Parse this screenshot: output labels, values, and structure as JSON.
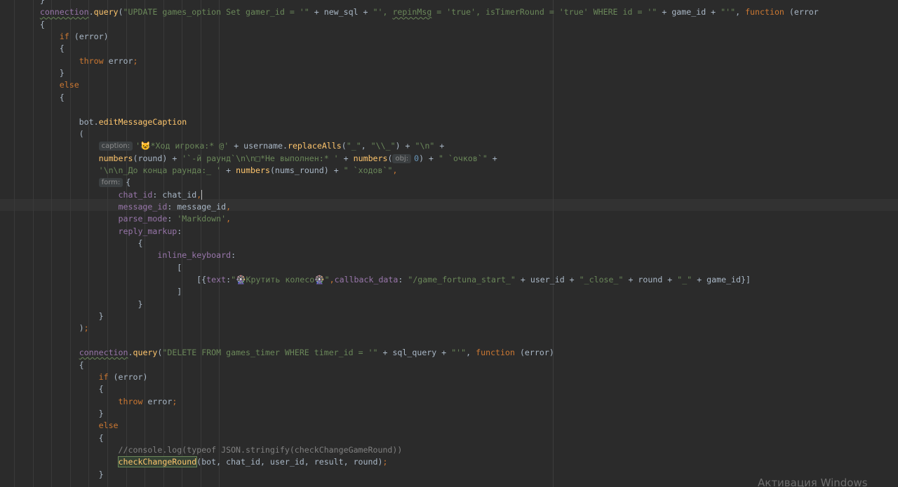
{
  "editor": {
    "lines": [
      {
        "segments": [
          {
            "t": "        }",
            "c": "op"
          }
        ]
      },
      {
        "segments": [
          {
            "t": "        ",
            "c": "op"
          },
          {
            "t": "connection",
            "c": "prop wavy"
          },
          {
            "t": ".",
            "c": "op"
          },
          {
            "t": "query",
            "c": "fn"
          },
          {
            "t": "(",
            "c": "op"
          },
          {
            "t": "\"UPDATE games_option Set gamer_id = '\"",
            "c": "str"
          },
          {
            "t": " + new_sql + ",
            "c": "op"
          },
          {
            "t": "\"', ",
            "c": "str"
          },
          {
            "t": "repinMsg",
            "c": "str wavy"
          },
          {
            "t": " = 'true', isTimerRound = 'true' WHERE id = '\"",
            "c": "str"
          },
          {
            "t": " + game_id + ",
            "c": "op"
          },
          {
            "t": "\"'\"",
            "c": "str"
          },
          {
            "t": ", ",
            "c": "op"
          },
          {
            "t": "function",
            "c": "kw"
          },
          {
            "t": " (error",
            "c": "op"
          }
        ]
      },
      {
        "segments": [
          {
            "t": "        {",
            "c": "op"
          }
        ]
      },
      {
        "segments": [
          {
            "t": "            ",
            "c": "op"
          },
          {
            "t": "if",
            "c": "kw"
          },
          {
            "t": " (error)",
            "c": "op"
          }
        ]
      },
      {
        "segments": [
          {
            "t": "            {",
            "c": "op"
          }
        ]
      },
      {
        "segments": [
          {
            "t": "                ",
            "c": "op"
          },
          {
            "t": "throw",
            "c": "kw"
          },
          {
            "t": " error",
            "c": "op"
          },
          {
            "t": ";",
            "c": "kw"
          }
        ]
      },
      {
        "segments": [
          {
            "t": "            }",
            "c": "op"
          }
        ]
      },
      {
        "segments": [
          {
            "t": "            ",
            "c": "op"
          },
          {
            "t": "else",
            "c": "kw"
          }
        ]
      },
      {
        "segments": [
          {
            "t": "            {",
            "c": "op"
          }
        ]
      },
      {
        "segments": [
          {
            "t": "",
            "c": "op"
          }
        ]
      },
      {
        "segments": [
          {
            "t": "                bot.",
            "c": "op"
          },
          {
            "t": "editMessageCaption",
            "c": "fn"
          }
        ]
      },
      {
        "segments": [
          {
            "t": "                (",
            "c": "op"
          }
        ]
      },
      {
        "segments": [
          {
            "t": "                    ",
            "c": "op"
          },
          {
            "t": "caption:",
            "c": "hint"
          },
          {
            "t": "'😺*Ход игрока:* @' ",
            "c": "str"
          },
          {
            "t": "+ username.",
            "c": "op"
          },
          {
            "t": "replaceAlls",
            "c": "fn"
          },
          {
            "t": "(",
            "c": "op"
          },
          {
            "t": "\"_\"",
            "c": "str"
          },
          {
            "t": ", ",
            "c": "op"
          },
          {
            "t": "\"\\\\_\"",
            "c": "str"
          },
          {
            "t": ") + ",
            "c": "op"
          },
          {
            "t": "\"\\n\"",
            "c": "str"
          },
          {
            "t": " +",
            "c": "op"
          }
        ]
      },
      {
        "segments": [
          {
            "t": "                    ",
            "c": "op"
          },
          {
            "t": "numbers",
            "c": "fn"
          },
          {
            "t": "(round) + ",
            "c": "op"
          },
          {
            "t": "'`-й раунд`\\n\\n□*Не выполнен:* '",
            "c": "str"
          },
          {
            "t": " + ",
            "c": "op"
          },
          {
            "t": "numbers",
            "c": "fn"
          },
          {
            "t": "(",
            "c": "op"
          },
          {
            "t": "obj:",
            "c": "hint"
          },
          {
            "t": "0",
            "c": "num"
          },
          {
            "t": ") + ",
            "c": "op"
          },
          {
            "t": "\" `очков`\"",
            "c": "str"
          },
          {
            "t": " +",
            "c": "op"
          }
        ]
      },
      {
        "segments": [
          {
            "t": "                    ",
            "c": "op"
          },
          {
            "t": "'\\n\\n_До конца раунда:_ '",
            "c": "str"
          },
          {
            "t": " + ",
            "c": "op"
          },
          {
            "t": "numbers",
            "c": "fn"
          },
          {
            "t": "(nums_round) + ",
            "c": "op"
          },
          {
            "t": "\" `ходов`\"",
            "c": "str"
          },
          {
            "t": ",",
            "c": "kw"
          }
        ]
      },
      {
        "segments": [
          {
            "t": "                    ",
            "c": "op"
          },
          {
            "t": "form:",
            "c": "hint"
          },
          {
            "t": "{",
            "c": "op"
          }
        ]
      },
      {
        "segments": [
          {
            "t": "                        ",
            "c": "op"
          },
          {
            "t": "chat_id",
            "c": "prop"
          },
          {
            "t": ": chat_id",
            "c": "op"
          },
          {
            "t": ",",
            "c": "kw"
          },
          {
            "t": "|caret|",
            "c": "caret"
          }
        ]
      },
      {
        "segments": [
          {
            "t": "                        ",
            "c": "op"
          },
          {
            "t": "message_id",
            "c": "prop"
          },
          {
            "t": ": message_id",
            "c": "op"
          },
          {
            "t": ",",
            "c": "kw"
          }
        ]
      },
      {
        "segments": [
          {
            "t": "                        ",
            "c": "op"
          },
          {
            "t": "parse_mode",
            "c": "prop"
          },
          {
            "t": ": ",
            "c": "op"
          },
          {
            "t": "'Markdown'",
            "c": "str"
          },
          {
            "t": ",",
            "c": "kw"
          }
        ]
      },
      {
        "segments": [
          {
            "t": "                        ",
            "c": "op"
          },
          {
            "t": "reply_markup",
            "c": "prop"
          },
          {
            "t": ":",
            "c": "op"
          }
        ]
      },
      {
        "segments": [
          {
            "t": "                            {",
            "c": "op"
          }
        ]
      },
      {
        "segments": [
          {
            "t": "                                ",
            "c": "op"
          },
          {
            "t": "inline_keyboard",
            "c": "prop"
          },
          {
            "t": ":",
            "c": "op"
          }
        ]
      },
      {
        "segments": [
          {
            "t": "                                    [",
            "c": "op"
          }
        ]
      },
      {
        "segments": [
          {
            "t": "                                        [{",
            "c": "op"
          },
          {
            "t": "text",
            "c": "prop"
          },
          {
            "t": ":",
            "c": "op"
          },
          {
            "t": "\"🎡Крутить колесо🎡\"",
            "c": "str"
          },
          {
            "t": ",",
            "c": "kw"
          },
          {
            "t": "callback_data",
            "c": "prop"
          },
          {
            "t": ": ",
            "c": "op"
          },
          {
            "t": "\"/game_fortuna_start_\"",
            "c": "str"
          },
          {
            "t": " + user_id + ",
            "c": "op"
          },
          {
            "t": "\"_close_\"",
            "c": "str"
          },
          {
            "t": " + round + ",
            "c": "op"
          },
          {
            "t": "\"_\"",
            "c": "str"
          },
          {
            "t": " + game_id}]",
            "c": "op"
          }
        ]
      },
      {
        "segments": [
          {
            "t": "                                    ]",
            "c": "op"
          }
        ]
      },
      {
        "segments": [
          {
            "t": "                            }",
            "c": "op"
          }
        ]
      },
      {
        "segments": [
          {
            "t": "                    }",
            "c": "op"
          }
        ]
      },
      {
        "segments": [
          {
            "t": "                )",
            "c": "op"
          },
          {
            "t": ";",
            "c": "kw"
          }
        ]
      },
      {
        "segments": [
          {
            "t": "",
            "c": "op"
          }
        ]
      },
      {
        "segments": [
          {
            "t": "                ",
            "c": "op"
          },
          {
            "t": "connection",
            "c": "prop wavy"
          },
          {
            "t": ".",
            "c": "op"
          },
          {
            "t": "query",
            "c": "fn"
          },
          {
            "t": "(",
            "c": "op"
          },
          {
            "t": "\"DELETE FROM games_timer WHERE timer_id = '\"",
            "c": "str"
          },
          {
            "t": " + sql_query + ",
            "c": "op"
          },
          {
            "t": "\"'\"",
            "c": "str"
          },
          {
            "t": ", ",
            "c": "op"
          },
          {
            "t": "function",
            "c": "kw"
          },
          {
            "t": " (error)",
            "c": "op"
          }
        ]
      },
      {
        "segments": [
          {
            "t": "                {",
            "c": "op"
          }
        ]
      },
      {
        "segments": [
          {
            "t": "                    ",
            "c": "op"
          },
          {
            "t": "if",
            "c": "kw"
          },
          {
            "t": " (error)",
            "c": "op"
          }
        ]
      },
      {
        "segments": [
          {
            "t": "                    {",
            "c": "op"
          }
        ]
      },
      {
        "segments": [
          {
            "t": "                        ",
            "c": "op"
          },
          {
            "t": "throw",
            "c": "kw"
          },
          {
            "t": " error",
            "c": "op"
          },
          {
            "t": ";",
            "c": "kw"
          }
        ]
      },
      {
        "segments": [
          {
            "t": "                    }",
            "c": "op"
          }
        ]
      },
      {
        "segments": [
          {
            "t": "                    ",
            "c": "op"
          },
          {
            "t": "else",
            "c": "kw"
          }
        ]
      },
      {
        "segments": [
          {
            "t": "                    {",
            "c": "op"
          }
        ]
      },
      {
        "segments": [
          {
            "t": "                        ",
            "c": "op"
          },
          {
            "t": "//console.log(typeof JSON.stringify(checkChangeGameRound))",
            "c": "cm"
          }
        ]
      },
      {
        "segments": [
          {
            "t": "                        ",
            "c": "op"
          },
          {
            "t": "checkChangeRound",
            "c": "hl"
          },
          {
            "t": "(bot, chat_id, user_id, result, round)",
            "c": "op"
          },
          {
            "t": ";",
            "c": "kw"
          }
        ]
      },
      {
        "segments": [
          {
            "t": "                    }",
            "c": "op"
          }
        ]
      }
    ]
  },
  "watermark": "Активация Windows",
  "colors": {
    "background": "#2b2b2b",
    "keyword": "#cc7832",
    "string": "#6a8759",
    "function": "#ffc66d",
    "property": "#9876aa",
    "number": "#6897bb",
    "comment": "#808080",
    "text": "#a9b7c6"
  }
}
